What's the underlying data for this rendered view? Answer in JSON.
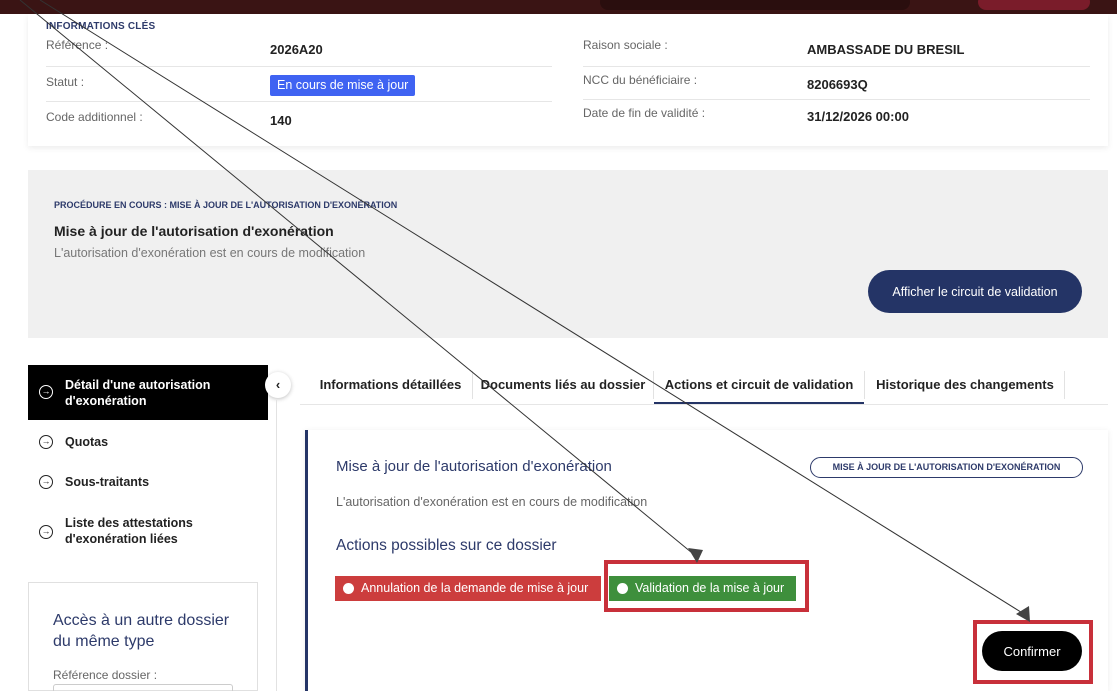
{
  "key_info": {
    "title": "INFORMATIONS CLÉS",
    "fields": [
      {
        "label": "Référence :",
        "value": "2026A20"
      },
      {
        "label": "Statut :",
        "value": "En cours de mise à jour"
      },
      {
        "label": "Code additionnel :",
        "value": "140"
      },
      {
        "label": "Raison sociale :",
        "value": "AMBASSADE DU BRESIL"
      },
      {
        "label": "NCC du bénéficiaire :",
        "value": "8206693Q"
      },
      {
        "label": "Date de fin de validité :",
        "value": "31/12/2026 00:00"
      }
    ]
  },
  "procedure": {
    "kicker": "PROCÉDURE EN COURS : MISE À JOUR DE L'AUTORISATION D'EXONÉRATION",
    "title": "Mise à jour de l'autorisation d'exonération",
    "description": "L'autorisation d'exonération est en cours de modification",
    "circuit_button": "Afficher le circuit de validation"
  },
  "sidebar": {
    "items": [
      {
        "label": "Détail d'une autorisation d'exonération",
        "active": true
      },
      {
        "label": "Quotas",
        "active": false
      },
      {
        "label": "Sous-traitants",
        "active": false
      },
      {
        "label": "Liste des attestations d'exonération liées",
        "active": false
      }
    ],
    "item_icon": "arrow-circle-right-icon",
    "collapse_icon": "chevron-left-icon",
    "collapse_glyph": "‹",
    "access": {
      "title": "Accès à un autre dossier du même type",
      "ref_label": "Référence dossier :"
    }
  },
  "tabs": [
    {
      "label": "Informations détaillées",
      "active": false
    },
    {
      "label": "Documents liés au dossier",
      "active": false
    },
    {
      "label": "Actions et circuit de validation",
      "active": true
    },
    {
      "label": "Historique des changements",
      "active": false
    }
  ],
  "actions": {
    "title": "Mise à jour de l'autorisation d'exonération",
    "tag": "MISE À JOUR DE L'AUTORISATION D'EXONÉRATION",
    "description": "L'autorisation d'exonération est en cours de modification",
    "subtitle": "Actions possibles sur ce dossier",
    "options": [
      {
        "label": "Annulation de la demande de mise à jour",
        "color": "#cc3d3d"
      },
      {
        "label": "Validation de la mise à jour",
        "color": "#3e8f3c"
      }
    ],
    "confirm_button": "Confirmer"
  },
  "colors": {
    "navy": "#243466",
    "status_badge": "#3f63f2",
    "highlight_box": "#c8303a"
  }
}
